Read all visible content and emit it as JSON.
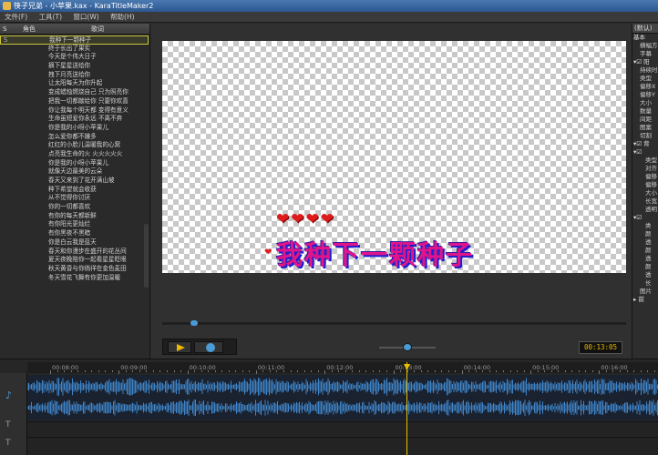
{
  "titlebar": {
    "title": "筷子兄弟 - 小苹果.kax - KaraTitleMaker2"
  },
  "menu": [
    "文件(F)",
    "工具(T)",
    "窗口(W)",
    "帮助(H)"
  ],
  "lyrics": {
    "headers": {
      "col1": "S",
      "col2": "角色",
      "col3": "歌词"
    },
    "rows": [
      {
        "s": "S",
        "text": "我种下一颗种子"
      },
      {
        "s": "",
        "text": "终于长出了果实"
      },
      {
        "s": "",
        "text": "今天是个伟大日子"
      },
      {
        "s": "",
        "text": "摘下星星送给你"
      },
      {
        "s": "",
        "text": "拽下月亮送给你"
      },
      {
        "s": "",
        "text": "让太阳每天为你升起"
      },
      {
        "s": "",
        "text": "变成蜡烛燃烧自己 只为照亮你"
      },
      {
        "s": "",
        "text": "把我一切都献给你 只要你欢喜"
      },
      {
        "s": "",
        "text": "你让我每个明天都 变得有意义"
      },
      {
        "s": "",
        "text": "生命虽短爱你永远 不离不弃"
      },
      {
        "s": "",
        "text": "你是我的小呀小苹果儿"
      },
      {
        "s": "",
        "text": "怎么爱你都不嫌多"
      },
      {
        "s": "",
        "text": "红红的小脸儿温暖我的心窝"
      },
      {
        "s": "",
        "text": "点亮我生命的火 火火火火火"
      },
      {
        "s": "",
        "text": "你是我的小呀小苹果儿"
      },
      {
        "s": "",
        "text": "就像天边最美的云朵"
      },
      {
        "s": "",
        "text": "春天又来到了花开满山坡"
      },
      {
        "s": "",
        "text": "种下希望就会收获"
      },
      {
        "s": "",
        "text": "从不觉得你讨厌"
      },
      {
        "s": "",
        "text": "你的一切都喜欢"
      },
      {
        "s": "",
        "text": "有你的每天都新鲜"
      },
      {
        "s": "",
        "text": "有你阳光更灿烂"
      },
      {
        "s": "",
        "text": "有你黑夜不黑暗"
      },
      {
        "s": "",
        "text": "你是白云我是蓝天"
      },
      {
        "s": "",
        "text": "春天和你漫步在盛开的花丛间"
      },
      {
        "s": "",
        "text": "夏天夜晚陪你一起看星星眨眼"
      },
      {
        "s": "",
        "text": "秋天黄昏与你徜徉在金色麦田"
      },
      {
        "s": "",
        "text": "冬天雪花飞舞有你更加温暖"
      }
    ]
  },
  "preview": {
    "hearts": "❤❤❤❤",
    "small_heart": "❤",
    "current_lyric": "我种下一颗种子",
    "colors": {
      "lyric_fill": "#e0158a",
      "lyric_outline": "#1a1fd0",
      "heart": "#e01b1b"
    }
  },
  "transport": {
    "time": "00:13:05"
  },
  "properties": {
    "header": "(默认)",
    "rows": [
      {
        "text": "基本",
        "kind": "grp"
      },
      {
        "text": "横幅方",
        "kind": ""
      },
      {
        "text": "字幕",
        "kind": ""
      },
      {
        "text": "▾☑ 阳",
        "kind": "grp"
      },
      {
        "text": "持续时",
        "kind": ""
      },
      {
        "text": "类型",
        "kind": ""
      },
      {
        "text": "偏移X",
        "kind": ""
      },
      {
        "text": "偏移Y",
        "kind": ""
      },
      {
        "text": "大小",
        "kind": ""
      },
      {
        "text": "数量",
        "kind": ""
      },
      {
        "text": "间距",
        "kind": ""
      },
      {
        "text": "图案",
        "kind": ""
      },
      {
        "text": "切割",
        "kind": ""
      },
      {
        "text": "▾☑ 背",
        "kind": "grp"
      },
      {
        "text": "▾☑",
        "kind": "grp"
      },
      {
        "text": "类型",
        "kind": "ind"
      },
      {
        "text": "对齐",
        "kind": "ind"
      },
      {
        "text": "偏移",
        "kind": "ind"
      },
      {
        "text": "偏移",
        "kind": "ind"
      },
      {
        "text": "大小",
        "kind": "ind"
      },
      {
        "text": "长宽",
        "kind": "ind"
      },
      {
        "text": "透明",
        "kind": "ind"
      },
      {
        "text": "▾☑",
        "kind": "grp"
      },
      {
        "text": "类",
        "kind": "ind"
      },
      {
        "text": "颜",
        "kind": "ind"
      },
      {
        "text": "透",
        "kind": "ind"
      },
      {
        "text": "颜",
        "kind": "ind"
      },
      {
        "text": "透",
        "kind": "ind"
      },
      {
        "text": "颜",
        "kind": "ind"
      },
      {
        "text": "透",
        "kind": "ind"
      },
      {
        "text": "长",
        "kind": "ind"
      },
      {
        "text": "图片",
        "kind": ""
      },
      {
        "text": "▸ 前",
        "kind": "grp"
      }
    ]
  },
  "timeline": {
    "ticks": [
      "00:08:00",
      "00:09:00",
      "00:10:00",
      "00:11:00",
      "00:12:00",
      "00:13:00",
      "00:14:00",
      "00:15:00",
      "00:16:00"
    ]
  }
}
